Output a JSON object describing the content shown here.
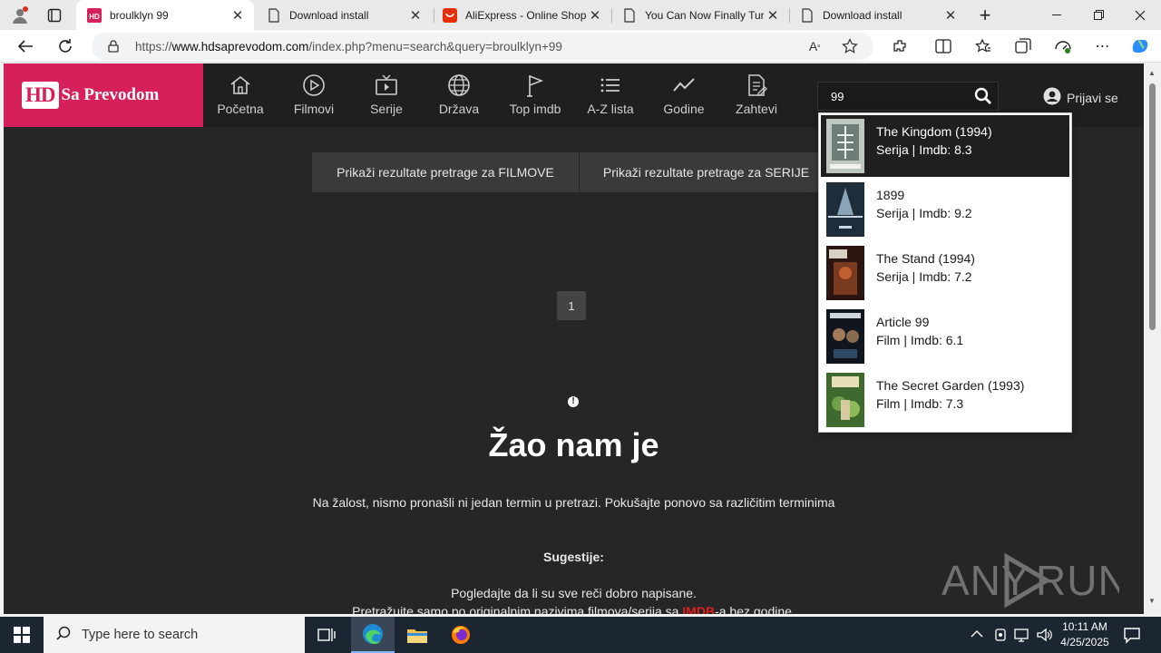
{
  "browser": {
    "tabs": [
      {
        "label": "broulklyn 99",
        "favicon": "hd-logo-icon"
      },
      {
        "label": "Download install",
        "favicon": "page-icon"
      },
      {
        "label": "AliExpress - Online Shopp",
        "favicon": "aliexpress-icon"
      },
      {
        "label": "You Can Now Finally Turn",
        "favicon": "page-icon"
      },
      {
        "label": "Download install",
        "favicon": "page-icon"
      }
    ],
    "url_prefix": "https://",
    "url_domain": "www.hdsaprevodom.com",
    "url_path": "/index.php?menu=search&query=broulklyn+99"
  },
  "site": {
    "logo_hd": "HD",
    "logo_text": "Sa Prevodom",
    "brand_color": "#d6205a",
    "nav": [
      {
        "label": "Početna",
        "icon": "home-icon"
      },
      {
        "label": "Filmovi",
        "icon": "play-circle-icon"
      },
      {
        "label": "Serije",
        "icon": "tv-icon"
      },
      {
        "label": "Država",
        "icon": "globe-icon"
      },
      {
        "label": "Top imdb",
        "icon": "flag-icon"
      },
      {
        "label": "A-Z lista",
        "icon": "list-icon"
      },
      {
        "label": "Godine",
        "icon": "trend-icon"
      },
      {
        "label": "Zahtevi",
        "icon": "document-edit-icon"
      }
    ],
    "search_value": "99",
    "login_label": "Prijavi se"
  },
  "main": {
    "btn_movies": "Prikaži rezultate pretrage za FILMOVE",
    "btn_series": "Prikaži rezultate pretrage za SERIJE",
    "page_number": "1",
    "warning_glyph": "!",
    "sorry_title": "Žao nam je",
    "sorry_text": "Na žalost, nismo pronašli ni jedan termin u pretrazi. Pokušajte ponovo sa različitim terminima",
    "suggestions_title": "Sugestije:",
    "suggestion_1": "Pogledajte da li su sve reči dobro napisane.",
    "suggestion_2_pre": "Pretražujte samo po originalnim nazivima filmova/serija sa ",
    "suggestion_2_link": "IMDB",
    "suggestion_2_post": "-a bez godine."
  },
  "dropdown": {
    "results": [
      {
        "title": "The Kingdom (1994)",
        "meta": "Serija | Imdb: 8.3",
        "active": true
      },
      {
        "title": "1899",
        "meta": "Serija | Imdb: 9.2",
        "active": false
      },
      {
        "title": "The Stand (1994)",
        "meta": "Serija | Imdb: 7.2",
        "active": false
      },
      {
        "title": "Article 99",
        "meta": "Film | Imdb: 6.1",
        "active": false
      },
      {
        "title": "The Secret Garden (1993)",
        "meta": "Film | Imdb: 7.3",
        "active": false
      }
    ]
  },
  "watermark": "ANY RUN",
  "taskbar": {
    "search_placeholder": "Type here to search",
    "time": "10:11 AM",
    "date": "4/25/2025"
  }
}
